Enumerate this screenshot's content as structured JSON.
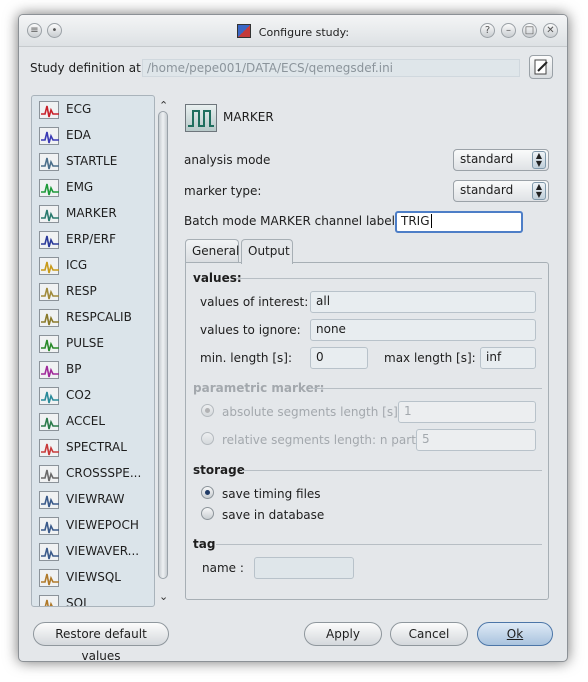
{
  "window": {
    "title": "Configure study:"
  },
  "study": {
    "label": "Study definition at:",
    "path": "/home/pepe001/DATA/ECS/qemegsdef.ini"
  },
  "list": {
    "items": [
      {
        "label": "ECG",
        "icon": "ecg-icon",
        "color": "#c8202a"
      },
      {
        "label": "EDA",
        "icon": "eda-icon",
        "color": "#3a3ab4"
      },
      {
        "label": "STARTLE",
        "icon": "startle-icon",
        "color": "#4a6e8a"
      },
      {
        "label": "EMG",
        "icon": "emg-icon",
        "color": "#1e9a3a"
      },
      {
        "label": "MARKER",
        "icon": "marker-icon",
        "color": "#2a7a6e"
      },
      {
        "label": "ERP/ERF",
        "icon": "erp-erf-icon",
        "color": "#2a3a9a"
      },
      {
        "label": "ICG",
        "icon": "icg-icon",
        "color": "#c89a1a"
      },
      {
        "label": "RESP",
        "icon": "resp-icon",
        "color": "#a08a3a"
      },
      {
        "label": "RESPCALIB",
        "icon": "respcalib-icon",
        "color": "#8a7a2a"
      },
      {
        "label": "PULSE",
        "icon": "pulse-icon",
        "color": "#2a8a2a"
      },
      {
        "label": "BP",
        "icon": "bp-icon",
        "color": "#a02a9a"
      },
      {
        "label": "CO2",
        "icon": "co2-icon",
        "color": "#2a8a9a"
      },
      {
        "label": "ACCEL",
        "icon": "accel-icon",
        "color": "#2a7a4a"
      },
      {
        "label": "SPECTRAL",
        "icon": "spectral-icon",
        "color": "#c83a3a"
      },
      {
        "label": "CROSSSPE...",
        "icon": "crossspectral-icon",
        "color": "#6a6a6a"
      },
      {
        "label": "VIEWRAW",
        "icon": "viewraw-icon",
        "color": "#3a5a8a"
      },
      {
        "label": "VIEWEPOCH",
        "icon": "viewepoch-icon",
        "color": "#3a5a8a"
      },
      {
        "label": "VIEWAVER...",
        "icon": "viewaverage-icon",
        "color": "#3a5a8a"
      },
      {
        "label": "VIEWSQL",
        "icon": "viewsql-icon",
        "color": "#b07a2a"
      },
      {
        "label": "SQL",
        "icon": "sql-icon",
        "color": "#b07a2a"
      }
    ]
  },
  "header": {
    "title": "MARKER"
  },
  "analysis_mode": {
    "label": "analysis mode",
    "value": "standard"
  },
  "marker_type": {
    "label": "marker type:",
    "value": "standard"
  },
  "batch_label": {
    "label": "Batch mode MARKER channel label:",
    "value": "TRIG"
  },
  "tabs": [
    {
      "label": "General"
    },
    {
      "label": "Output"
    }
  ],
  "values": {
    "title": "values:",
    "interest_label": "values of interest:",
    "interest_value": "all",
    "ignore_label": "values to ignore:",
    "ignore_value": "none",
    "min_label": "min. length [s]:",
    "min_value": "0",
    "max_label": "max length [s]:",
    "max_value": "inf"
  },
  "parametric": {
    "title": "parametric marker:",
    "absolute_label": "absolute segments length [s]:",
    "absolute_value": "1",
    "relative_label": "relative segments length: n parts:",
    "relative_value": "5"
  },
  "storage": {
    "title": "storage",
    "timing_label": "save timing files",
    "database_label": "save in database"
  },
  "tag": {
    "title": "tag",
    "name_label": "name :",
    "name_value": ""
  },
  "buttons": {
    "restore": "Restore default values",
    "apply": "Apply",
    "cancel": "Cancel",
    "ok": "Ok"
  }
}
